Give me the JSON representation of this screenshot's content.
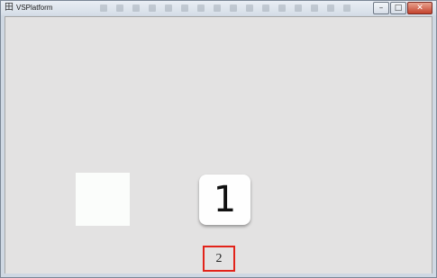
{
  "window": {
    "title": "VSPlatform",
    "controls": {
      "minimize": "–",
      "maximize": "□",
      "close": "✕"
    }
  },
  "content": {
    "tile_number": "1",
    "page_indicator": "2"
  },
  "icons": {
    "app_icon": "grid-icon"
  },
  "colors": {
    "highlight_border": "#e2231a",
    "client_background": "#e3e2e2"
  }
}
